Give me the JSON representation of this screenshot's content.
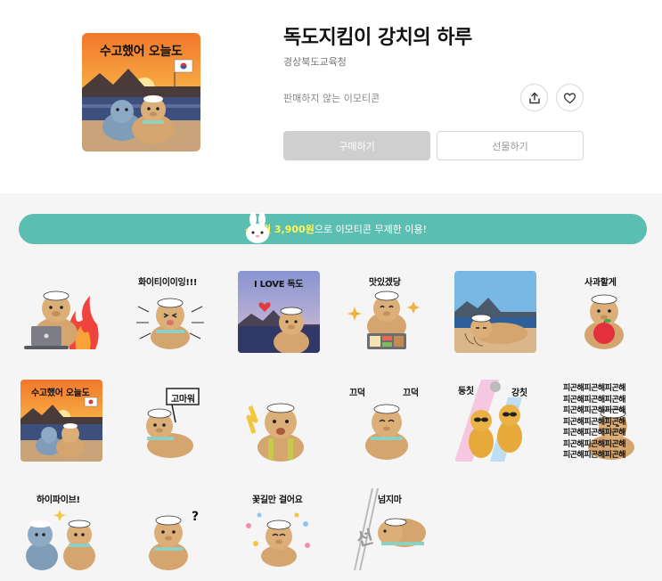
{
  "product": {
    "title": "독도지킴이 강치의 하루",
    "publisher": "경상북도교육청",
    "sale_notice": "판매하지 않는 이모티콘",
    "buy_label": "구매하기",
    "gift_label": "선물하기",
    "thumbnail_caption": "수고했어 오늘도"
  },
  "promo": {
    "highlight": "월 3,900원",
    "rest": "으로 이모티콘 무제한 이용!"
  },
  "stickers": [
    {
      "name": "sticker-laptop-fire",
      "caption": ""
    },
    {
      "name": "sticker-fighting",
      "caption": "화이티이이잉!!!"
    },
    {
      "name": "sticker-i-love-dokdo",
      "caption": "I LOVE 독도"
    },
    {
      "name": "sticker-delicious",
      "caption": "맛있겠당"
    },
    {
      "name": "sticker-beach-sleep",
      "caption": ""
    },
    {
      "name": "sticker-apology",
      "caption": "사과할게"
    },
    {
      "name": "sticker-good-job",
      "caption": "수고했어 오늘도"
    },
    {
      "name": "sticker-thanks",
      "caption": "고마워"
    },
    {
      "name": "sticker-shocked",
      "caption": ""
    },
    {
      "name": "sticker-nod",
      "caption": "끄덕"
    },
    {
      "name": "sticker-dance",
      "caption": "둥칫"
    },
    {
      "name": "sticker-tired",
      "caption": "피곤해피곤해피곤해"
    },
    {
      "name": "sticker-high-five",
      "caption": "하이파이브!"
    },
    {
      "name": "sticker-question",
      "caption": "?"
    },
    {
      "name": "sticker-flower-road",
      "caption": "꽃길만 걸어요"
    },
    {
      "name": "sticker-dont-cross",
      "caption": "넘지마"
    }
  ],
  "sticker_extra": {
    "nod_right": "끄덕",
    "dance_right": "강칫",
    "line_mark": "선"
  },
  "colors": {
    "promo_bg": "#5abfb0",
    "seal_body": "#d4a56f",
    "seal_blue": "#7f9cb8",
    "buy_disabled": "#cfcfcf"
  },
  "icons": {
    "share": "share-icon",
    "like": "heart-icon",
    "promo": "rabbit-mascot-icon"
  }
}
